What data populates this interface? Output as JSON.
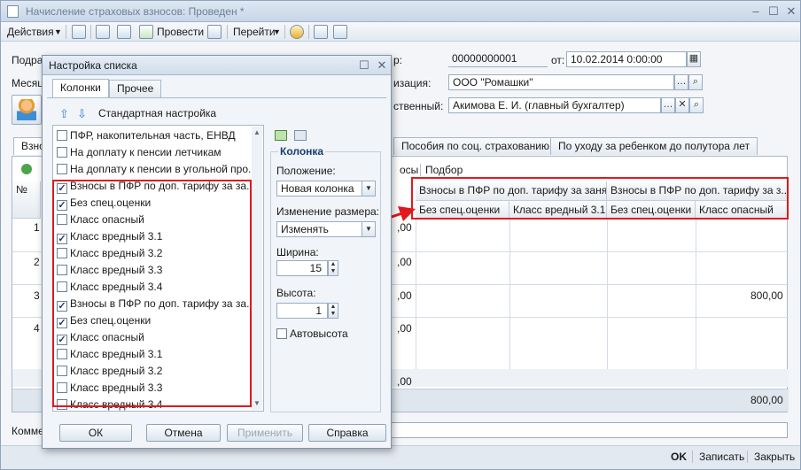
{
  "window": {
    "title": "Начисление страховых взносов: Проведен *"
  },
  "toolbar": {
    "actions": "Действия",
    "post": "Провести",
    "goto": "Перейти"
  },
  "form": {
    "podr_label": "Подра",
    "month_label": "Месяц",
    "num_label_tail": "р:",
    "number": "00000000001",
    "date_label": "от:",
    "date": "10.02.2014  0:00:00",
    "org_label_tail": "изация:",
    "org": "ООО \"Ромашки\"",
    "resp_label_tail": "ственный:",
    "resp": "Акимова Е. И. (главный бухгалтер)",
    "comment_label": "Комме"
  },
  "main_tabs": [
    "Взнос",
    "Пособия по соц. страхованию",
    "По уходу за ребенком до полутора лет"
  ],
  "grid": {
    "toolbar_tail": "осы",
    "select": "Подбор",
    "col_n": "№",
    "head_group1": "Взносы в ПФР по доп. тарифу за заня...",
    "head_group2": "Взносы в ПФР по доп. тарифу за з...",
    "sub_headers": [
      "Без спец.оценки",
      "Класс вредный 3.1",
      "Без спец.оценки",
      "Класс опасный"
    ],
    "row_nums": [
      "1",
      "2",
      "3",
      "4"
    ],
    "left_vals": [
      ",00",
      ",00",
      ",00",
      ",00"
    ],
    "row3_val": "800,00",
    "footer_left": ",00",
    "footer_total": "800,00"
  },
  "dialog": {
    "title": "Настройка списка",
    "tabs": [
      "Колонки",
      "Прочее"
    ],
    "std_setting": "Стандартная настройка",
    "items": [
      {
        "label": "ПФР, накопительная часть, ЕНВД",
        "checked": false
      },
      {
        "label": "На доплату к пенсии летчикам",
        "checked": false
      },
      {
        "label": "На доплату к пенсии в угольной про...",
        "checked": false
      },
      {
        "label": "Взносы в ПФР по доп. тарифу за за...",
        "checked": true
      },
      {
        "label": "Без спец.оценки",
        "checked": true
      },
      {
        "label": "Класс опасный",
        "checked": false
      },
      {
        "label": "Класс вредный 3.1",
        "checked": true
      },
      {
        "label": "Класс вредный 3.2",
        "checked": false
      },
      {
        "label": "Класс вредный 3.3",
        "checked": false
      },
      {
        "label": "Класс вредный 3.4",
        "checked": false
      },
      {
        "label": "Взносы в ПФР по доп. тарифу за за...",
        "checked": true
      },
      {
        "label": "Без спец.оценки",
        "checked": true
      },
      {
        "label": "Класс опасный",
        "checked": true
      },
      {
        "label": "Класс вредный 3.1",
        "checked": false
      },
      {
        "label": "Класс вредный 3.2",
        "checked": false
      },
      {
        "label": "Класс вредный 3.3",
        "checked": false
      },
      {
        "label": "Класс вредный 3.4",
        "checked": false
      }
    ],
    "group_title": "Колонка",
    "position_label": "Положение:",
    "position_value": "Новая колонка",
    "resize_label": "Изменение размера:",
    "resize_value": "Изменять",
    "width_label": "Ширина:",
    "width_value": "15",
    "height_label": "Высота:",
    "height_value": "1",
    "autoheight": "Автовысота",
    "buttons": {
      "ok": "ОК",
      "cancel": "Отмена",
      "apply": "Применить",
      "help": "Справка"
    }
  },
  "bottom": {
    "ok": "OK",
    "save": "Записать",
    "close": "Закрыть"
  }
}
